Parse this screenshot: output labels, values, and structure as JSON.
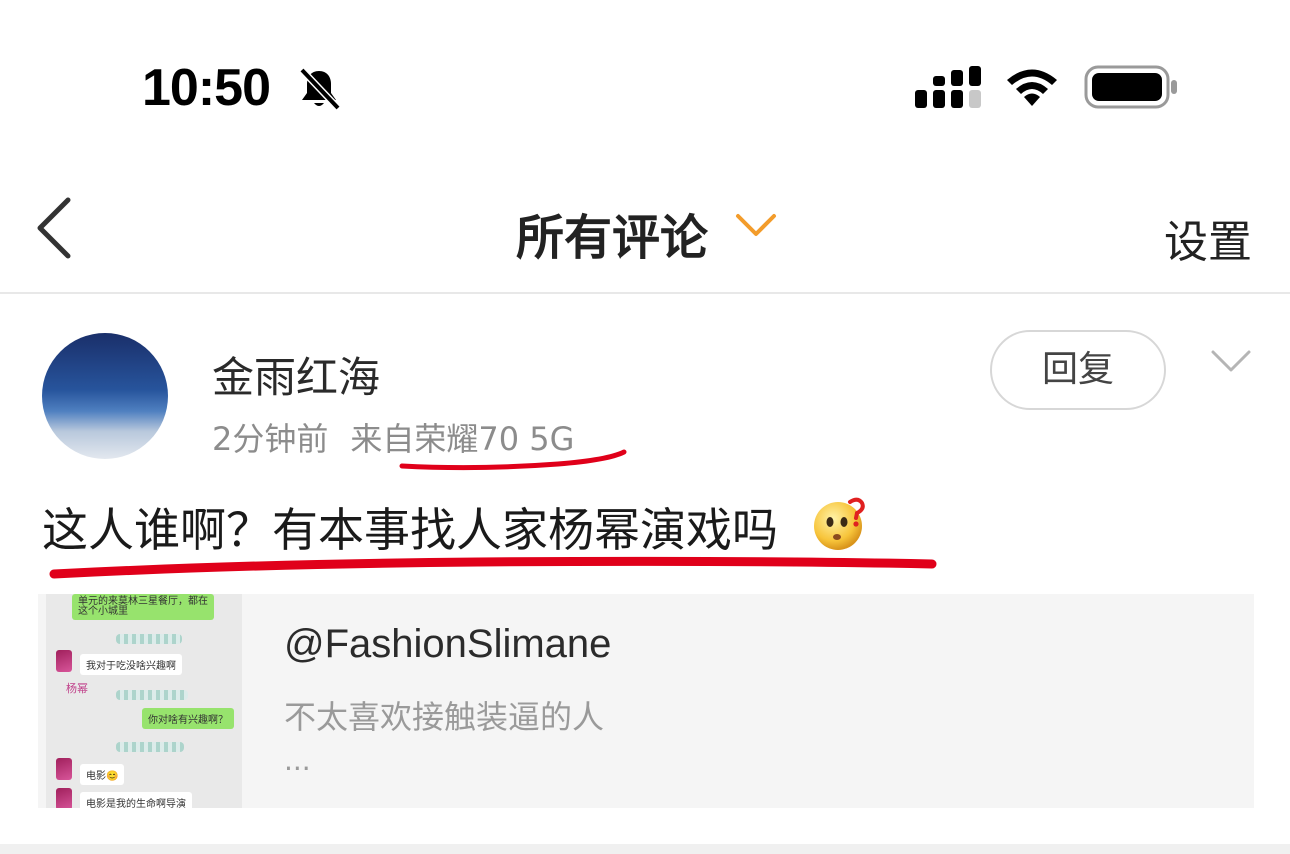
{
  "status_bar": {
    "time": "10:50",
    "icons": [
      "bell-slash-icon",
      "cellular-signal-icon",
      "wifi-icon",
      "battery-icon"
    ]
  },
  "nav": {
    "title": "所有评论",
    "settings_label": "设置",
    "icons": [
      "back-chevron-icon",
      "chevron-down-icon"
    ],
    "accent_color": "#f39c2b"
  },
  "comment": {
    "username": "金雨红海",
    "time": "2分钟前",
    "source": "来自荣耀70 5G",
    "reply_label": "回复",
    "text": "这人谁啊？有本事找人家杨幂演戏吗",
    "emoji": "thinking-question-emoji",
    "annotation_color": "#e0001a"
  },
  "card": {
    "title": "@FashionSlimane",
    "description": "不太喜欢接触装逼的人",
    "more": "...",
    "thumbnail": {
      "messages": [
        {
          "side": "right",
          "text": "单元的来莫林三星餐厅，都在这个小城里"
        },
        {
          "side": "left",
          "text": "我对于吃没啥兴趣啊"
        },
        {
          "side": "right",
          "text": "你对啥有兴趣啊？"
        },
        {
          "side": "left",
          "text": "电影😊"
        },
        {
          "side": "left",
          "text": "电影是我的生命啊导演"
        }
      ],
      "name_tag": "杨幂"
    }
  }
}
